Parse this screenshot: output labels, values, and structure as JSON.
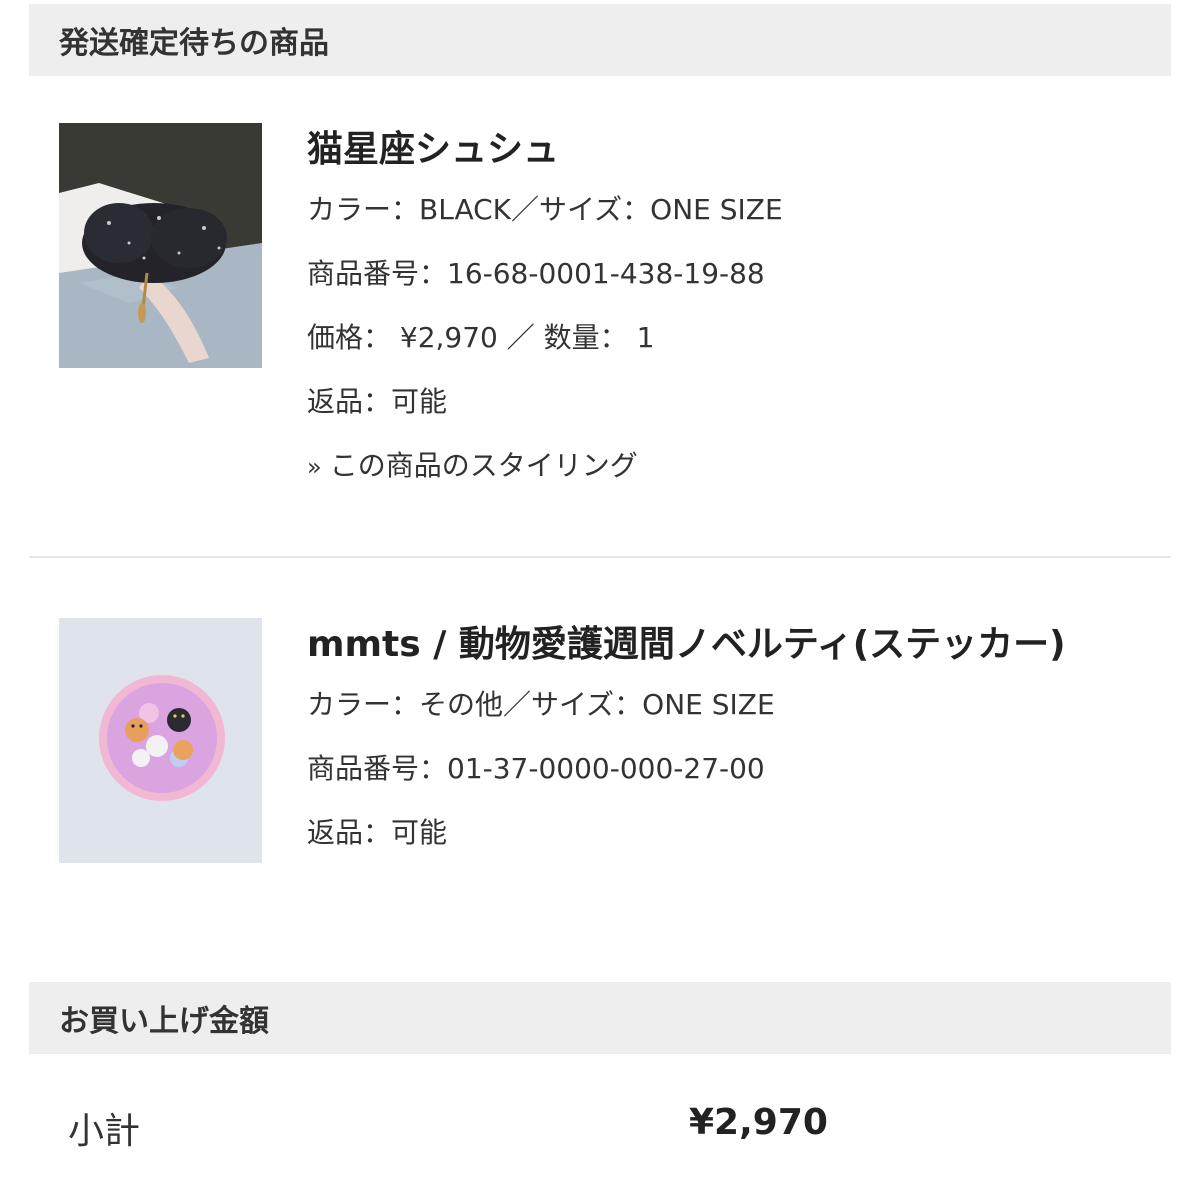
{
  "pending_section": {
    "title": "発送確定待ちの商品"
  },
  "products": [
    {
      "name": "猫星座シュシュ",
      "color_size": "カラー：BLACK／サイズ：ONE SIZE",
      "product_number": "商品番号：16-68-0001-438-19-88",
      "price_qty": "価格： ¥2,970 ／ 数量： 1",
      "returns": "返品：可能",
      "styling_link": "この商品のスタイリング",
      "styling_arrow": "»"
    },
    {
      "name": "mmts / 動物愛護週間ノベルティ(ステッカー)",
      "color_size": "カラー：その他／サイズ：ONE SIZE",
      "product_number": "商品番号：01-37-0000-000-27-00",
      "returns": "返品：可能"
    }
  ],
  "total_section": {
    "title": "お買い上げ金額",
    "subtotal_label": "小計",
    "subtotal_value": "¥2,970"
  },
  "colors": {
    "header_bg": "#eeeeee",
    "divider": "#e6e6e6",
    "text": "#333333"
  },
  "icons": {
    "styling_link": "chevron-right-double"
  }
}
